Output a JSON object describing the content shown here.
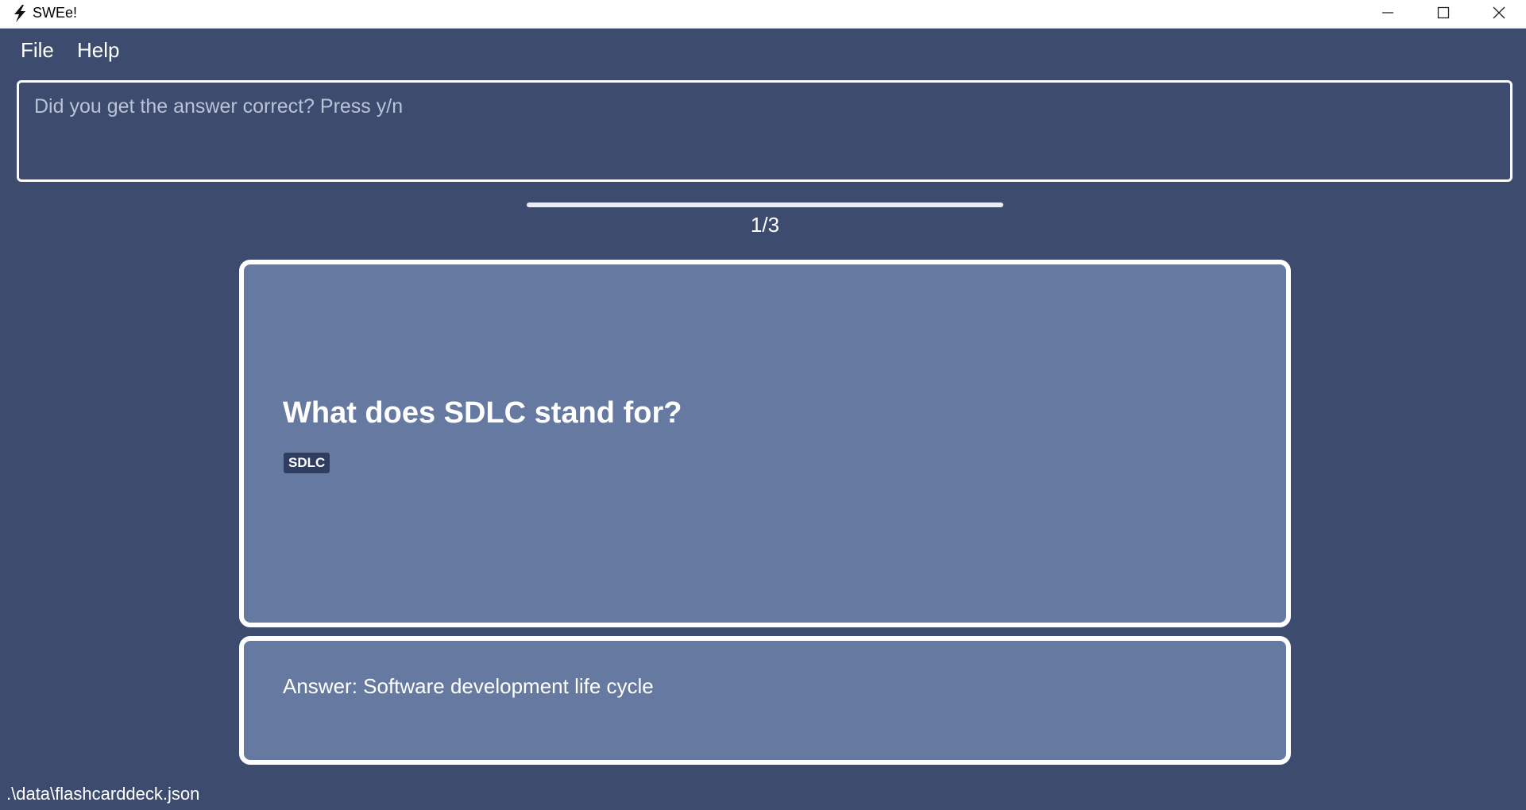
{
  "window": {
    "title": "SWEe!",
    "icon": "lightning-bolt-icon"
  },
  "menu": {
    "items": [
      {
        "label": "File"
      },
      {
        "label": "Help"
      }
    ]
  },
  "command_box": {
    "text": "Did you get the answer correct? Press y/n"
  },
  "progress": {
    "label": "1/3",
    "fraction": 1.0
  },
  "question_card": {
    "question": "What does SDLC stand for?",
    "tag": "SDLC"
  },
  "answer_card": {
    "text": "Answer: Software development life cycle"
  },
  "status_bar": {
    "path": ".\\data\\flashcarddeck.json"
  },
  "colors": {
    "background": "#3d4c6e",
    "card": "#6679a0",
    "card_border": "#ffffff",
    "tag_bg": "#2f3d5e"
  }
}
